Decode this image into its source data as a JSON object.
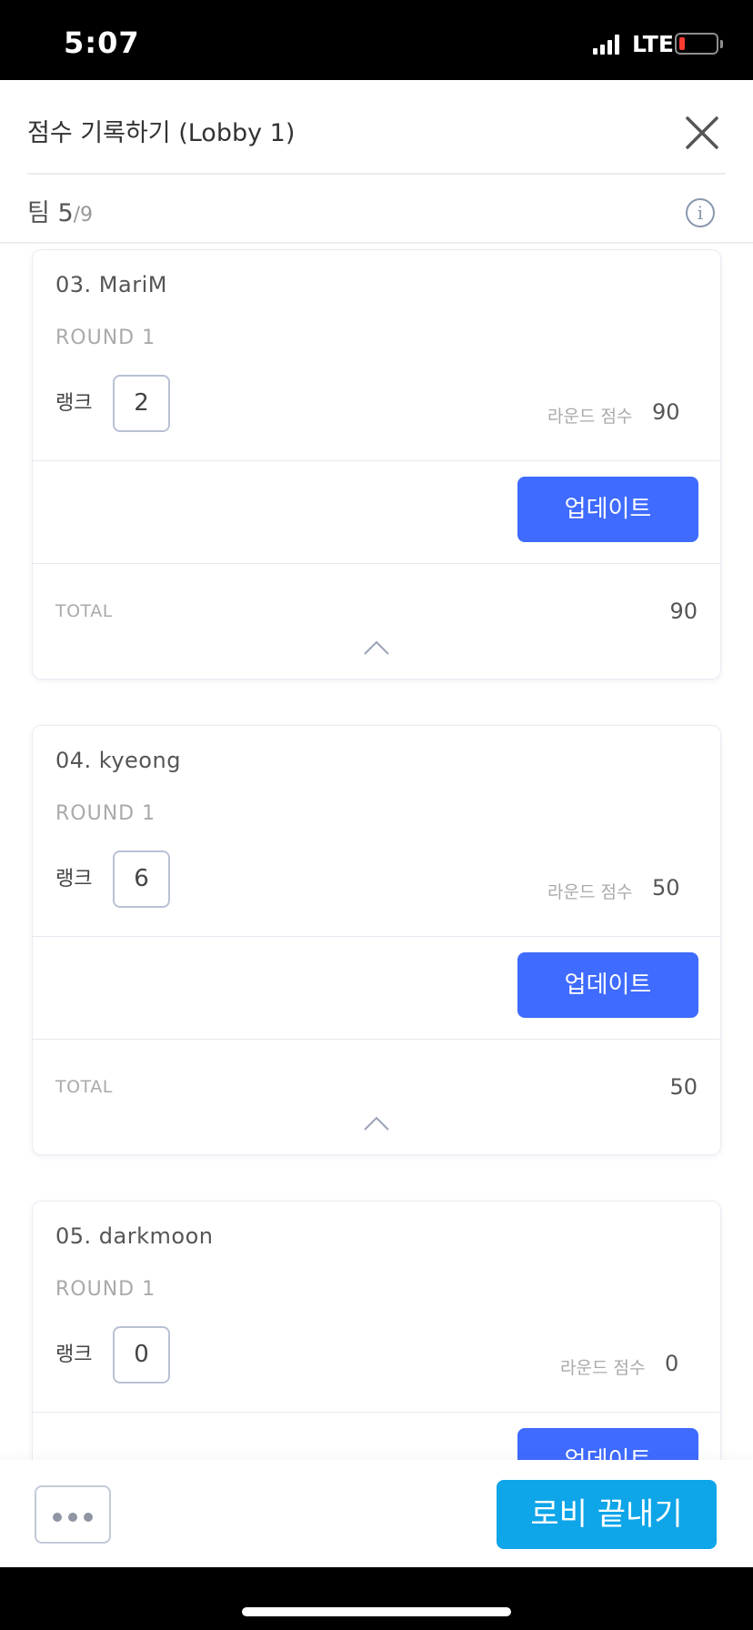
{
  "status_bar": {
    "time": "5:07",
    "network": "LTE",
    "battery_color": "#ff3b30"
  },
  "header": {
    "title": "점수 기록하기 (Lobby 1)",
    "close_icon": "close-icon"
  },
  "team": {
    "label": "팀",
    "current": "5",
    "total": "/9",
    "info_icon": "info-icon"
  },
  "players": [
    {
      "name": "03. MariM",
      "round": "ROUND 1",
      "rank_label": "랭크",
      "rank": "2",
      "round_score_label": "라운드 점수",
      "round_score": "90",
      "update_label": "업데이트",
      "total_label": "TOTAL",
      "total": "90"
    },
    {
      "name": "04. kyeong",
      "round": "ROUND 1",
      "rank_label": "랭크",
      "rank": "6",
      "round_score_label": "라운드 점수",
      "round_score": "50",
      "update_label": "업데이트",
      "total_label": "TOTAL",
      "total": "50"
    },
    {
      "name": "05. darkmoon",
      "round": "ROUND 1",
      "rank_label": "랭크",
      "rank": "0",
      "round_score_label": "라운드 점수",
      "round_score": "0",
      "update_label": "업데이트"
    }
  ],
  "bottom": {
    "more_icon": "more-icon",
    "end_lobby_label": "로비 끝내기"
  },
  "colors": {
    "accent": "#3f6bff",
    "end_button": "#0ea5e9"
  }
}
